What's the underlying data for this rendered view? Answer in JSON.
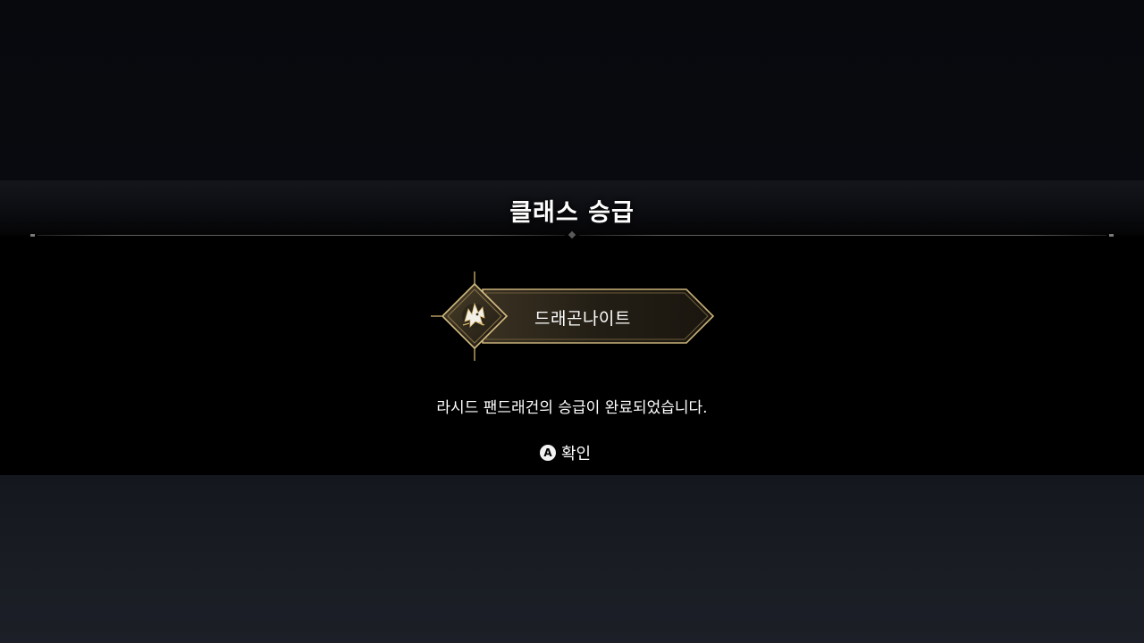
{
  "dialog": {
    "title": "클래스 승급",
    "class_name": "드래곤나이트",
    "class_icon": "dragon-emblem-icon",
    "message": "라시드 팬드래건의 승급이 완료되었습니다.",
    "confirm": {
      "button_glyph": "A",
      "label": "확인"
    }
  },
  "colors": {
    "gold_accent": "#c9b27a",
    "badge_fill": "#2a2418",
    "overlay": "#000000",
    "text": "#ffffff"
  }
}
